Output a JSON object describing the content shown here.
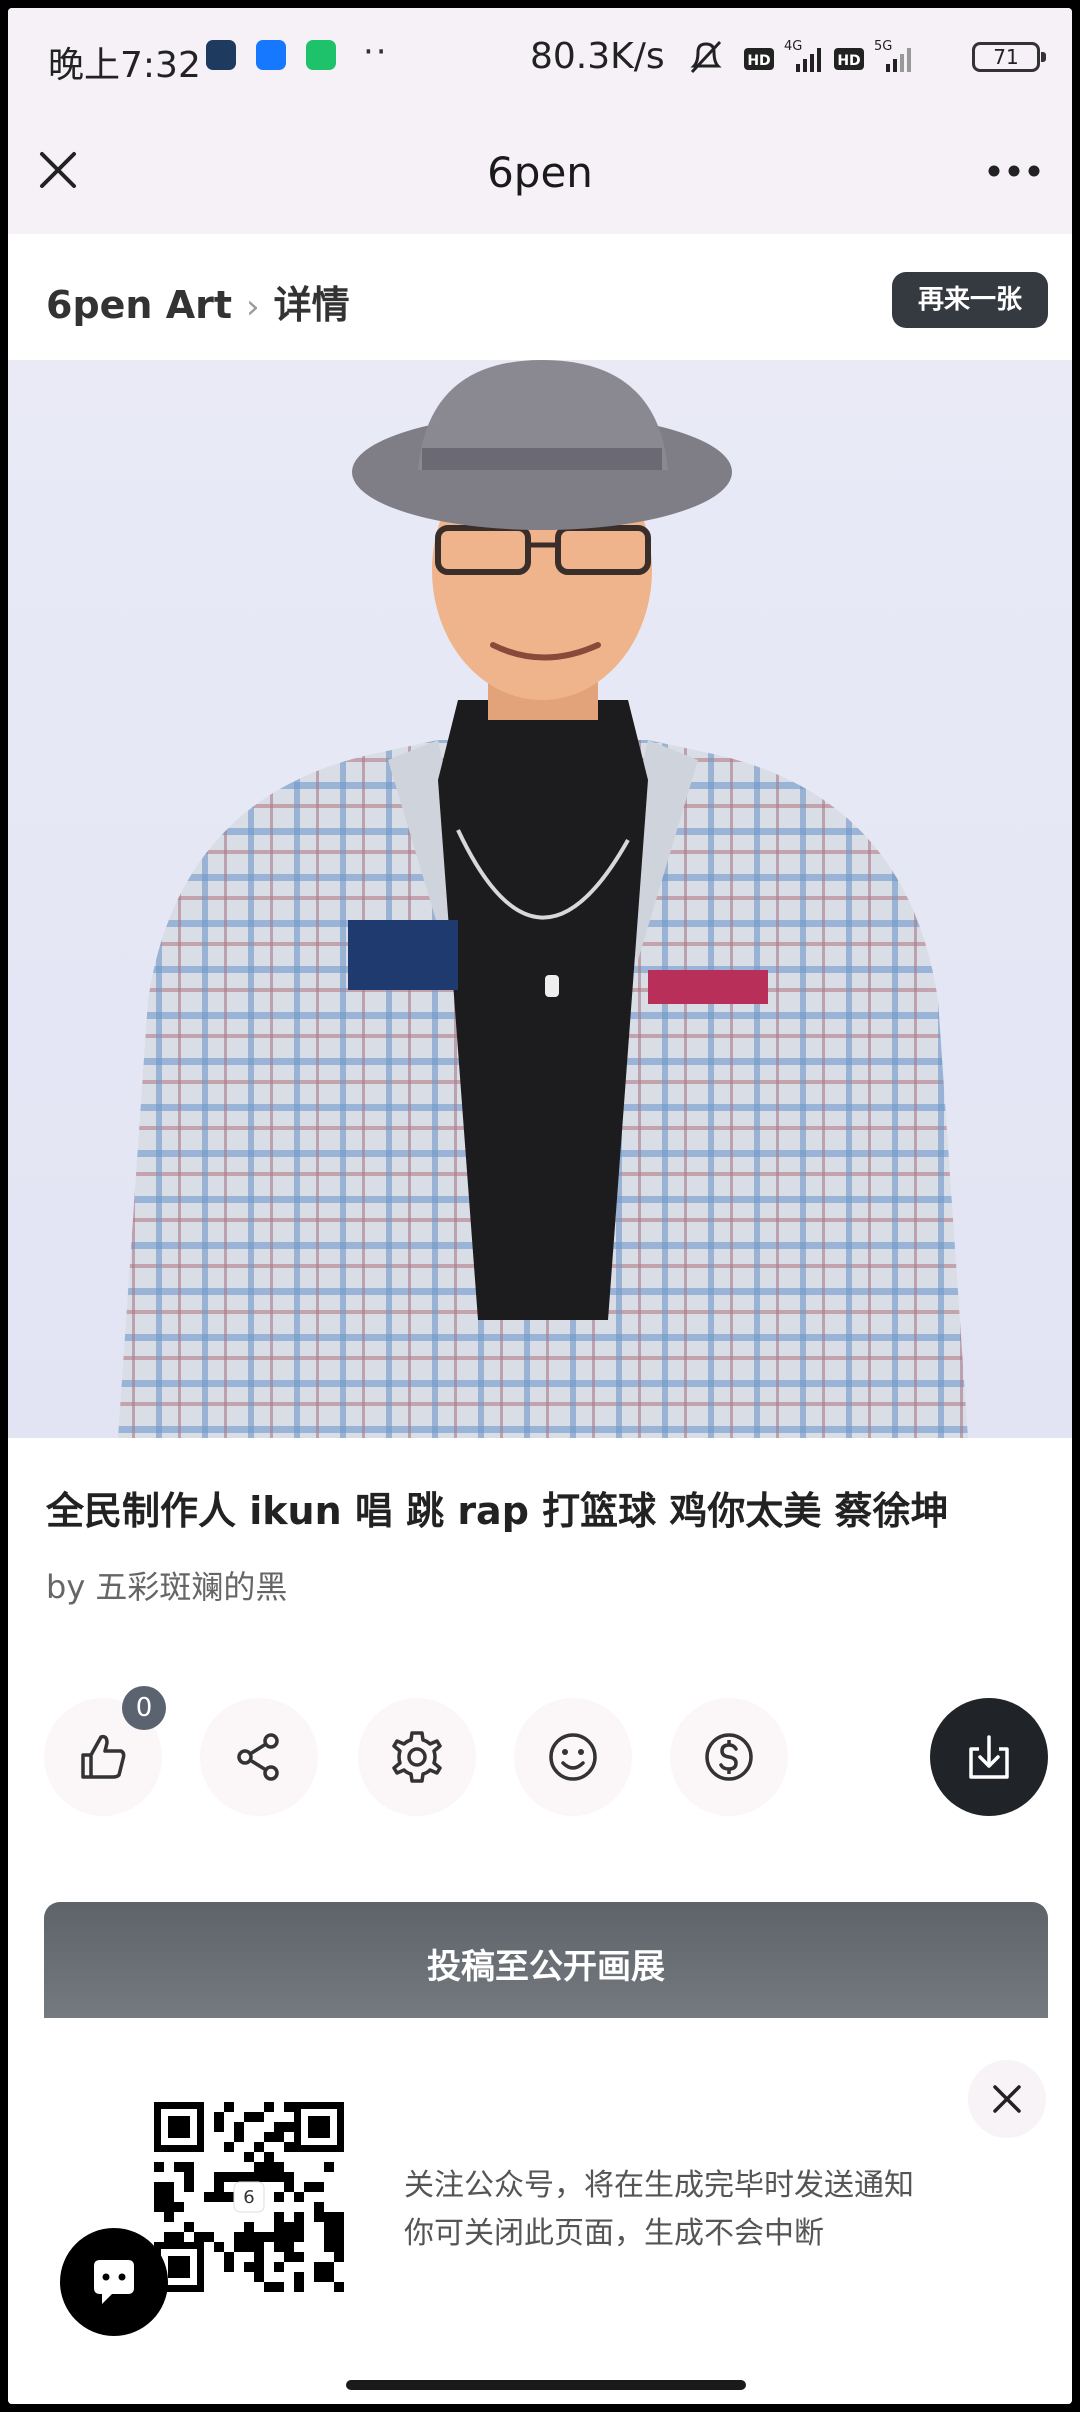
{
  "status_bar": {
    "time": "晚上7:32",
    "more_dots": "··",
    "net_speed": "80.3K/s",
    "battery": "71"
  },
  "titlebar": {
    "title": "6pen"
  },
  "breadcrumb": {
    "root": "6pen Art",
    "separator": "›",
    "current": "详情"
  },
  "again_button": "再来一张",
  "artwork": {
    "title": "全民制作人 ikun 唱 跳 rap 打篮球 鸡你太美 蔡徐坤",
    "author": "by 五彩斑斓的黑"
  },
  "actions": {
    "like_count": "0",
    "icons": [
      "thumbs-up-icon",
      "share-icon",
      "gear-icon",
      "smiley-icon",
      "dollar-coin-icon",
      "download-icon"
    ]
  },
  "submit_button": "投稿至公开画展",
  "follow_panel": {
    "line1": "关注公众号，将在生成完毕时发送通知",
    "line2": "你可关闭此页面，生成不会中断"
  }
}
